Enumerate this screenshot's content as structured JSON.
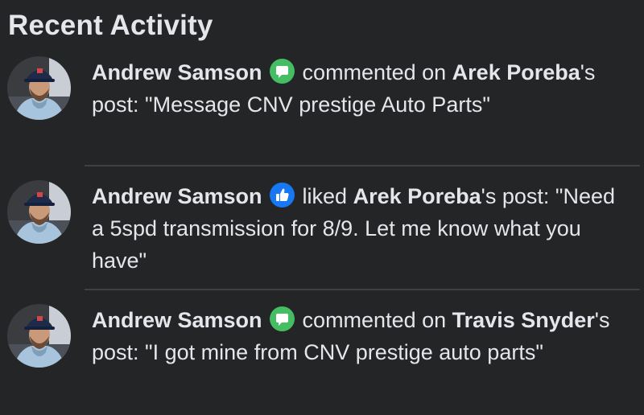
{
  "header": {
    "title": "Recent Activity"
  },
  "colors": {
    "comment_badge": "#45bd62",
    "like_badge": "#1877f2"
  },
  "activities": [
    {
      "actor": "Andrew Samson",
      "badge_icon": "comment-icon",
      "verb": "commented on",
      "target_first": "Arek",
      "target_rest": "Poreba",
      "post_suffix": "'s post: ",
      "quote": "\"Message CNV prestige Auto Parts\""
    },
    {
      "actor": "Andrew Samson",
      "badge_icon": "like-icon",
      "verb": "liked",
      "target_first": "Arek Poreba",
      "target_rest": "",
      "post_suffix": "'s post: ",
      "quote": "\"Need a 5spd transmission for 8/9. Let me know what you have\""
    },
    {
      "actor": "Andrew Samson",
      "badge_icon": "comment-icon",
      "verb": "commented on",
      "target_first": "Travis",
      "target_rest": "Snyder",
      "post_suffix": "'s post: ",
      "quote": "\"I got mine from CNV prestige auto parts\""
    }
  ]
}
